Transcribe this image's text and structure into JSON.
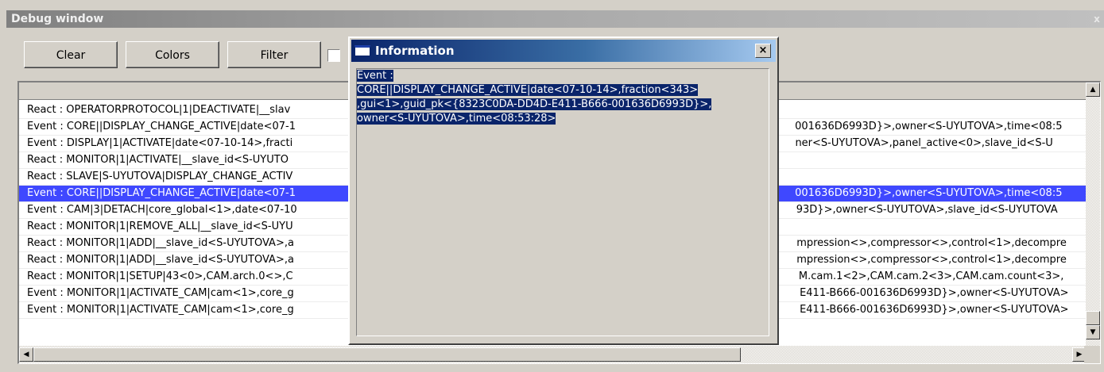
{
  "window": {
    "title": "Debug window",
    "title_button": "x"
  },
  "toolbar": {
    "clear_label": "Clear",
    "colors_label": "Colors",
    "filter_label": "Filter"
  },
  "list": {
    "rows": [
      "React : OPERATORPROTOCOL|1|DEACTIVATE|__slav",
      "Event : CORE||DISPLAY_CHANGE_ACTIVE|date<07-1                                                                                                                                                        001636D6993D}>,owner<S-UYUTOVA>,time<08:5",
      "Event : DISPLAY|1|ACTIVATE|date<07-10-14>,fracti                                                                                                                                                         ner<S-UYUTOVA>,panel_active<0>,slave_id<S-U",
      "React : MONITOR|1|ACTIVATE|__slave_id<S-UYUTO",
      "React : SLAVE|S-UYUTOVA|DISPLAY_CHANGE_ACTIV",
      "Event : CORE||DISPLAY_CHANGE_ACTIVE|date<07-1                                                                                                                                                        001636D6993D}>,owner<S-UYUTOVA>,time<08:5",
      "Event : CAM|3|DETACH|core_global<1>,date<07-10                                                                                                                                                        93D}>,owner<S-UYUTOVA>,slave_id<S-UYUTOVA",
      "React : MONITOR|1|REMOVE_ALL|__slave_id<S-UYU",
      "React : MONITOR|1|ADD|__slave_id<S-UYUTOVA>,a                                                                                                                                                         mpression<>,compressor<>,control<1>,decompre",
      "React : MONITOR|1|ADD|__slave_id<S-UYUTOVA>,a                                                                                                                                                         mpression<>,compressor<>,control<1>,decompre",
      "React : MONITOR|1|SETUP|43<0>,CAM.arch.0<>,C                                                                                                                                                          M.cam.1<2>,CAM.cam.2<3>,CAM.cam.count<3>,",
      "Event : MONITOR|1|ACTIVATE_CAM|cam<1>,core_g                                                                                                                                                          E411-B666-001636D6993D}>,owner<S-UYUTOVA>",
      "Event : MONITOR|1|ACTIVATE_CAM|cam<1>,core_g                                                                                                                                                          E411-B666-001636D6993D}>,owner<S-UYUTOVA>"
    ],
    "selected_index": 5
  },
  "dialog": {
    "title": "Information",
    "close_label": "×",
    "lines": [
      "Event :",
      "CORE||DISPLAY_CHANGE_ACTIVE|date<07-10-14>,fraction<343>",
      ",gui<1>,guid_pk<{8323C0DA-DD4D-E411-B666-001636D6993D}>,",
      "owner<S-UYUTOVA>,time<08:53:28>"
    ]
  }
}
